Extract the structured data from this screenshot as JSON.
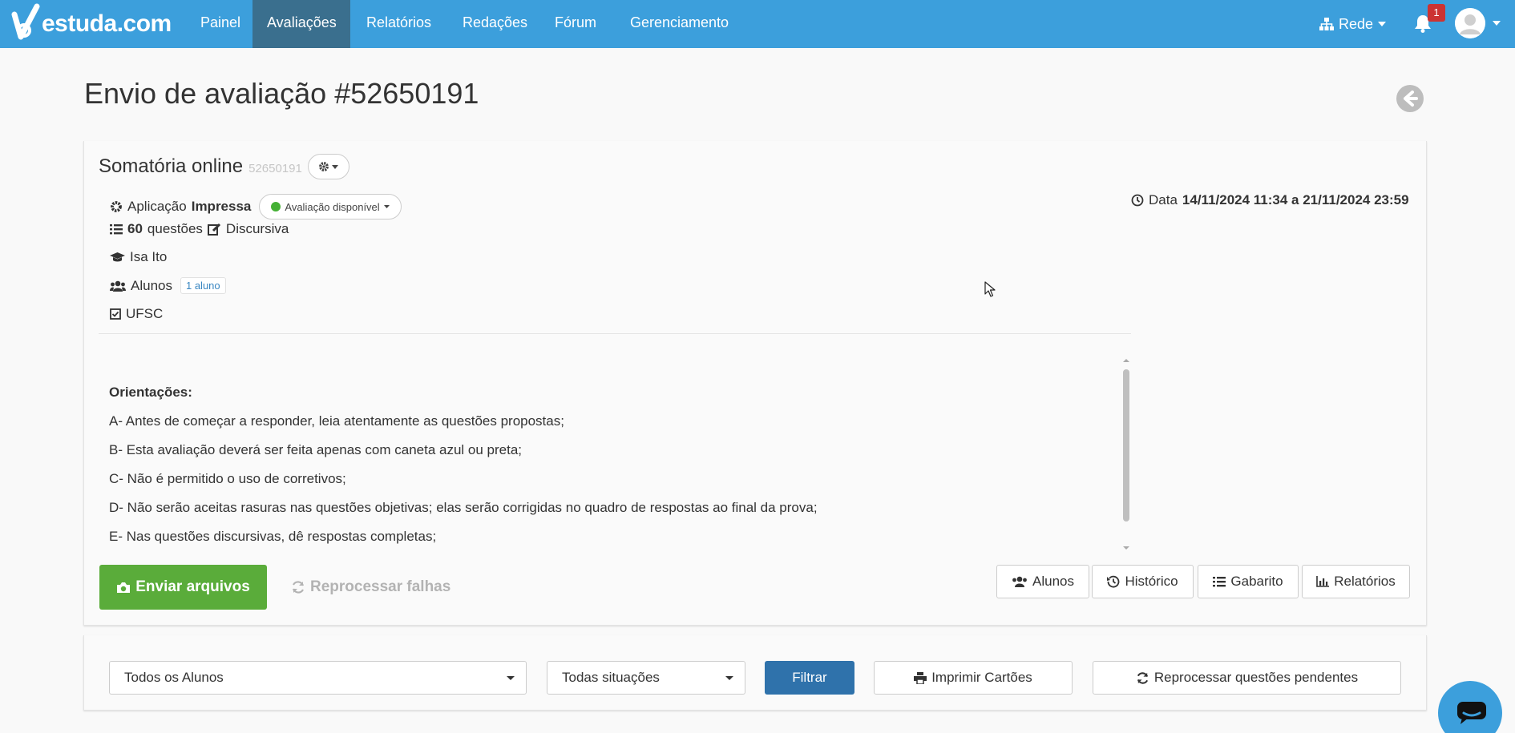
{
  "brand": {
    "logo_text": "estuda.com",
    "primary_color": "#3c9fdc",
    "active_nav_color": "#3a6f8e"
  },
  "navbar": {
    "links": [
      {
        "label": "Painel",
        "active": false
      },
      {
        "label": "Avaliações",
        "active": true
      },
      {
        "label": "Relatórios",
        "active": false
      },
      {
        "label": "Redações",
        "active": false
      },
      {
        "label": "Fórum",
        "active": false
      },
      {
        "label": "Gerenciamento",
        "active": false
      }
    ],
    "network_label": "Rede",
    "network_icon": "sitemap-icon",
    "notification_count": "1",
    "notification_icon": "bell-icon",
    "avatar_icon": "user-avatar-icon"
  },
  "page": {
    "title": "Envio de avaliação #52650191",
    "back_icon": "arrow-left-circle-icon"
  },
  "evaluation": {
    "name": "Somatória online",
    "id": "52650191",
    "application_label": "Aplicação",
    "application_value": "Impressa",
    "status": "Avaliação disponível",
    "status_color": "#45b035",
    "question_count": "60",
    "questions_label": "questões",
    "question_type": "Discursiva",
    "teacher": "Isa Ito",
    "students_label": "Alunos",
    "students_badge": "1 aluno",
    "institution": "UFSC",
    "date_label": "Data",
    "date_range": "14/11/2024 11:34 a 21/11/2024 23:59"
  },
  "instructions": {
    "title": "Orientações:",
    "lines": [
      "A- Antes de começar a responder, leia atentamente as questões propostas;",
      "B- Esta avaliação deverá ser feita apenas com caneta azul ou preta;",
      "C- Não é permitido o uso de corretivos;",
      "D- Não serão aceitas rasuras nas questões objetivas; elas serão corrigidas no quadro de respostas ao final da prova;",
      "E- Nas questões discursivas, dê respostas completas;"
    ]
  },
  "actions": {
    "upload": "Enviar arquivos",
    "reprocess_failures": "Reprocessar falhas",
    "students": "Alunos",
    "history": "Histórico",
    "answer_key": "Gabarito",
    "reports": "Relatórios"
  },
  "filters": {
    "students_select": "Todos os Alunos",
    "situation_select": "Todas situações",
    "filter_button": "Filtrar",
    "print_cards": "Imprimir Cartões",
    "reprocess_pending": "Reprocessar questões pendentes"
  },
  "chat": {
    "icon": "chat-bubble-icon"
  }
}
